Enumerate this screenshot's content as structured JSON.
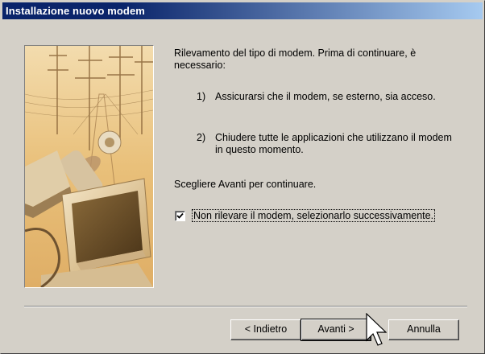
{
  "window": {
    "title": "Installazione nuovo modem"
  },
  "content": {
    "intro": "Rilevamento del tipo di modem. Prima di continuare, è necessario:",
    "steps": [
      {
        "num": "1)",
        "text": "Assicurarsi che il modem, se esterno, sia acceso."
      },
      {
        "num": "2)",
        "text": "Chiudere tutte le applicazioni che utilizzano il modem in questo momento."
      }
    ],
    "continue_text": "Scegliere Avanti per continuare.",
    "checkbox": {
      "label": "Non rilevare il modem, selezionarlo successivamente.",
      "checked": true
    }
  },
  "buttons": {
    "back": "< Indietro",
    "next": "Avanti >",
    "cancel": "Annulla"
  },
  "colors": {
    "titlebar_start": "#0a246a",
    "titlebar_end": "#a6caf0",
    "face": "#d4d0c8"
  },
  "icons": {
    "checkmark": "check-icon",
    "cursor": "mouse-pointer-icon"
  }
}
